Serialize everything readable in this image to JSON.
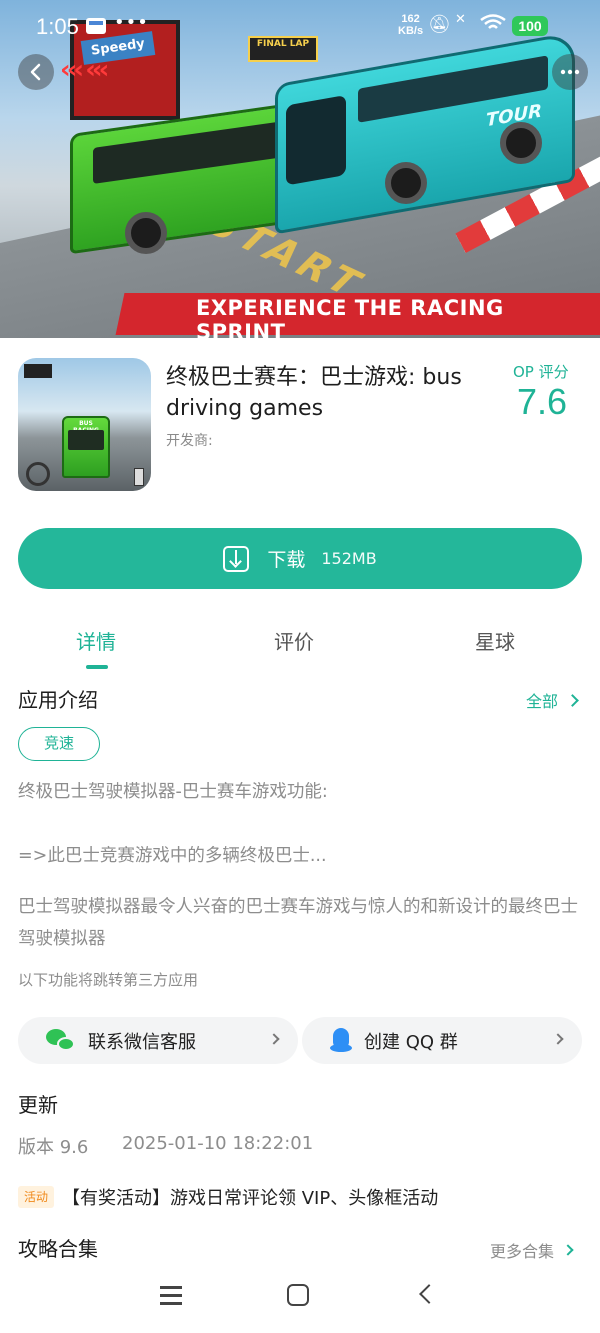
{
  "status_bar": {
    "time": "1:05",
    "network_speed_value": "162",
    "network_speed_unit": "KB/s",
    "battery": "100"
  },
  "hero": {
    "banner_text": "EXPERIENCE THE RACING SPRINT",
    "ground_text": "START",
    "sign_text": "Speedy",
    "flag_text": "FINAL LAP",
    "bus_text": "TOUR",
    "back_icon": "chevron-left-icon",
    "more_icon": "more-dots-icon"
  },
  "app": {
    "title": "终极巴士赛车：巴士游戏: bus driving games",
    "developer_label": "开发商:",
    "score_label": "OP 评分",
    "score_value": "7.6",
    "icon_label": "BUS RACING"
  },
  "download": {
    "label": "下载",
    "size": "152MB",
    "icon": "download-icon"
  },
  "tabs": [
    {
      "label": "详情",
      "active": true
    },
    {
      "label": "评价",
      "active": false
    },
    {
      "label": "星球",
      "active": false
    }
  ],
  "intro": {
    "title": "应用介绍",
    "all_link": "全部",
    "tag": "竞速",
    "description_1": "终极巴士驾驶模拟器-巴士赛车游戏功能:",
    "description_2": "=>此巴士竞赛游戏中的多辆终极巴士...",
    "description_3": "巴士驾驶模拟器最令人兴奋的巴士赛车游戏与惊人的和新设计的最终巴士驾驶模拟器",
    "third_party_note": "以下功能将跳转第三方应用"
  },
  "contacts": {
    "wechat_label": "联系微信客服",
    "qq_label": "创建 QQ 群"
  },
  "update": {
    "title": "更新",
    "version": "版本 9.6",
    "date": "2025-01-10 18:22:01",
    "promo_badge": "活动",
    "promo_text": "【有奖活动】游戏日常评论领 VIP、头像框活动"
  },
  "guides": {
    "title": "攻略合集",
    "more_link": "更多合集"
  },
  "colors": {
    "accent": "#1fb396",
    "download_button": "#24b79a",
    "promo": "#f08a1c"
  }
}
